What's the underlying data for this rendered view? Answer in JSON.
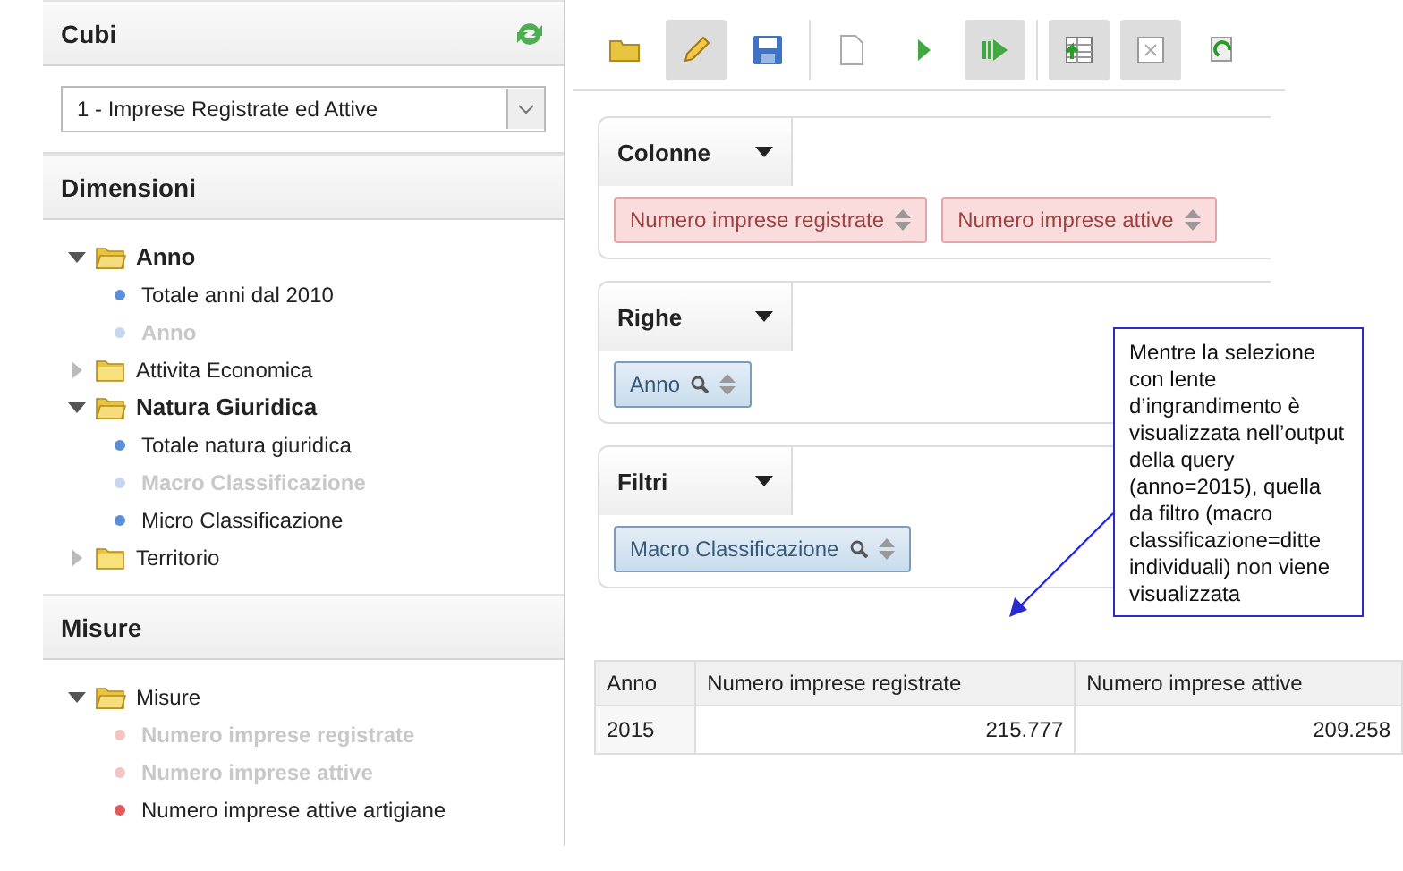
{
  "cubes_panel": {
    "title": "Cubi",
    "cube_select": {
      "value": "1 - Imprese Registrate ed Attive"
    }
  },
  "dimensions_panel": {
    "title": "Dimensioni",
    "tree": [
      {
        "label": "Anno",
        "kind": "folder",
        "expanded": true,
        "in_use": true,
        "children": [
          {
            "label": "Totale anni dal 2010",
            "kind": "leaf",
            "disabled": false,
            "color": "#5b8ed6"
          },
          {
            "label": "Anno",
            "kind": "leaf",
            "disabled": true,
            "color": "#c5d7ee"
          }
        ]
      },
      {
        "label": "Attivita Economica",
        "kind": "folder",
        "expanded": false,
        "in_use": false
      },
      {
        "label": "Natura Giuridica",
        "kind": "folder",
        "expanded": true,
        "in_use": true,
        "children": [
          {
            "label": "Totale natura giuridica",
            "kind": "leaf",
            "disabled": false,
            "color": "#5b8ed6"
          },
          {
            "label": "Macro Classificazione",
            "kind": "leaf",
            "disabled": true,
            "color": "#c5d7ee"
          },
          {
            "label": "Micro Classificazione",
            "kind": "leaf",
            "disabled": false,
            "color": "#5b8ed6"
          }
        ]
      },
      {
        "label": "Territorio",
        "kind": "folder",
        "expanded": false,
        "in_use": false
      }
    ]
  },
  "measures_panel": {
    "title": "Misure",
    "tree": [
      {
        "label": "Misure",
        "kind": "folder",
        "expanded": true,
        "in_use": false,
        "children": [
          {
            "label": "Numero imprese registrate",
            "kind": "leaf",
            "disabled": true,
            "color": "#f2c4c4"
          },
          {
            "label": "Numero imprese attive",
            "kind": "leaf",
            "disabled": true,
            "color": "#f2c4c4"
          },
          {
            "label": "Numero imprese attive artigiane",
            "kind": "leaf",
            "disabled": false,
            "color": "#e05a5a"
          }
        ]
      }
    ]
  },
  "toolbar": [
    {
      "kind": "open",
      "pressed": false
    },
    {
      "kind": "edit",
      "pressed": true
    },
    {
      "kind": "save",
      "pressed": false
    },
    {
      "kind": "separator"
    },
    {
      "kind": "new",
      "pressed": false
    },
    {
      "kind": "run",
      "pressed": false
    },
    {
      "kind": "auto-run",
      "pressed": true
    },
    {
      "kind": "separator"
    },
    {
      "kind": "table",
      "pressed": true
    },
    {
      "kind": "hide-table",
      "pressed": true
    },
    {
      "kind": "refresh",
      "pressed": false
    }
  ],
  "axes": [
    {
      "title": "Colonne",
      "chips": [
        {
          "label": "Numero imprese registrate",
          "kind": "measure",
          "filtered": false
        },
        {
          "label": "Numero imprese attive",
          "kind": "measure",
          "filtered": false
        }
      ]
    },
    {
      "title": "Righe",
      "chips": [
        {
          "label": "Anno",
          "kind": "dimension",
          "filtered": true
        }
      ]
    },
    {
      "title": "Filtri",
      "chips": [
        {
          "label": "Macro Classificazione",
          "kind": "dimension",
          "filtered": true
        }
      ]
    }
  ],
  "result_table": {
    "columns": [
      "Anno",
      "Numero imprese registrate",
      "Numero imprese attive"
    ],
    "rows": [
      [
        "2015",
        "215.777",
        "209.258"
      ]
    ]
  },
  "callout": {
    "text": "Mentre la selezione con lente d’ingrandimento è visualizzata nell’output della query (anno=2015), quella da filtro (macro classificazione=ditte individuali) non viene visualizzata"
  }
}
